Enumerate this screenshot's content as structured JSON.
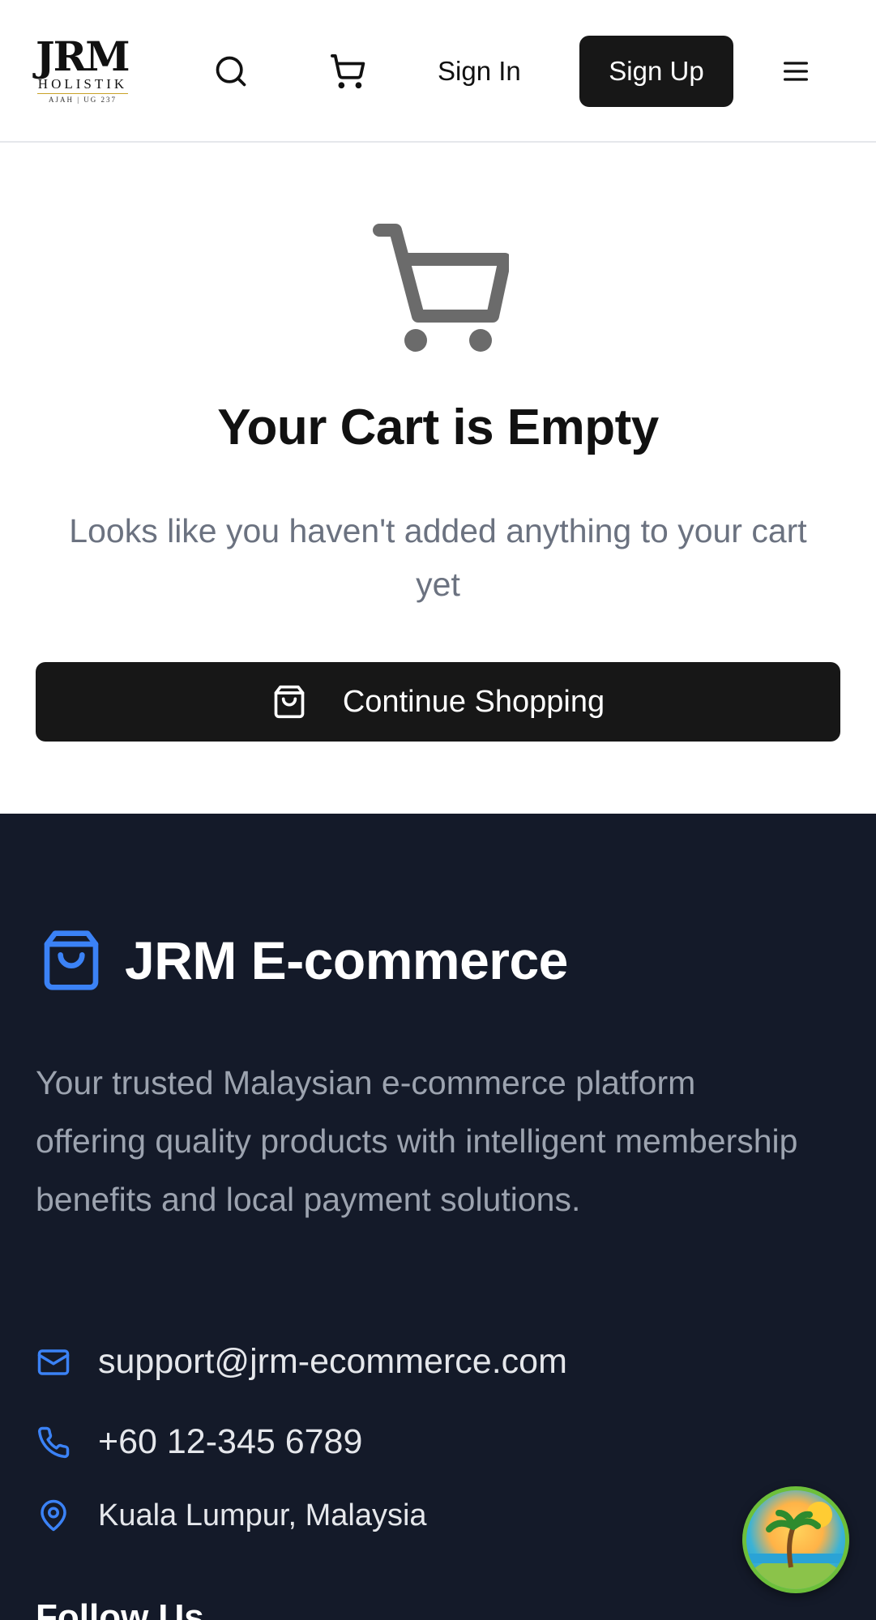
{
  "header": {
    "logo": {
      "main": "JRM",
      "sub": "HOLISTIK",
      "tag": "AJAH | UG 237"
    },
    "sign_in": "Sign In",
    "sign_up": "Sign Up"
  },
  "empty_cart": {
    "title": "Your Cart is Empty",
    "subtitle": "Looks like you haven't added anything to your cart yet",
    "button": "Continue Shopping"
  },
  "footer": {
    "brand": "JRM E-commerce",
    "description": "Your trusted Malaysian e-commerce platform offering quality products with intelligent membership benefits and local payment solutions.",
    "email": "support@jrm-ecommerce.com",
    "phone": "+60 12-345 6789",
    "location": "Kuala Lumpur, Malaysia",
    "follow_heading": "Follow Us"
  },
  "colors": {
    "accent": "#3b82f6",
    "footer_bg": "#141a29",
    "button_bg": "#171717"
  },
  "icons": [
    "search-icon",
    "cart-icon",
    "menu-icon",
    "shopping-bag-icon",
    "mail-icon",
    "phone-icon",
    "map-pin-icon"
  ]
}
